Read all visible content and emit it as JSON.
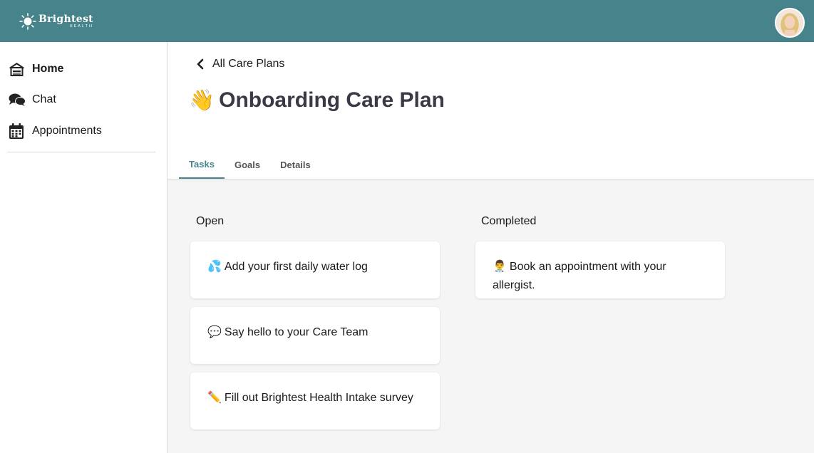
{
  "brand": {
    "name": "Brightest",
    "sub": "HEALTH"
  },
  "user": {
    "avatar_alt": "user-avatar"
  },
  "sidebar": {
    "items": [
      {
        "label": "Home",
        "icon": "home-icon",
        "active": true
      },
      {
        "label": "Chat",
        "icon": "chat-icon",
        "active": false
      },
      {
        "label": "Appointments",
        "icon": "calendar-icon",
        "active": false
      }
    ]
  },
  "header": {
    "back_label": "All Care Plans",
    "title_emoji": "👋",
    "title": "Onboarding Care Plan",
    "tabs": [
      {
        "label": "Tasks",
        "active": true
      },
      {
        "label": "Goals",
        "active": false
      },
      {
        "label": "Details",
        "active": false
      }
    ]
  },
  "columns": {
    "open": {
      "title": "Open",
      "tasks": [
        {
          "emoji": "💦",
          "text": "Add your first daily water log"
        },
        {
          "emoji": "💬",
          "text": "Say hello to your Care Team"
        },
        {
          "emoji": "✏️",
          "text": "Fill out Brightest Health Intake survey"
        }
      ]
    },
    "completed": {
      "title": "Completed",
      "tasks": [
        {
          "emoji": "👨‍⚕️",
          "text": "Book an appointment with your allergist."
        }
      ]
    }
  },
  "colors": {
    "brand": "#46838a",
    "title": "#3a3a47",
    "background": "#f5f5f5"
  }
}
